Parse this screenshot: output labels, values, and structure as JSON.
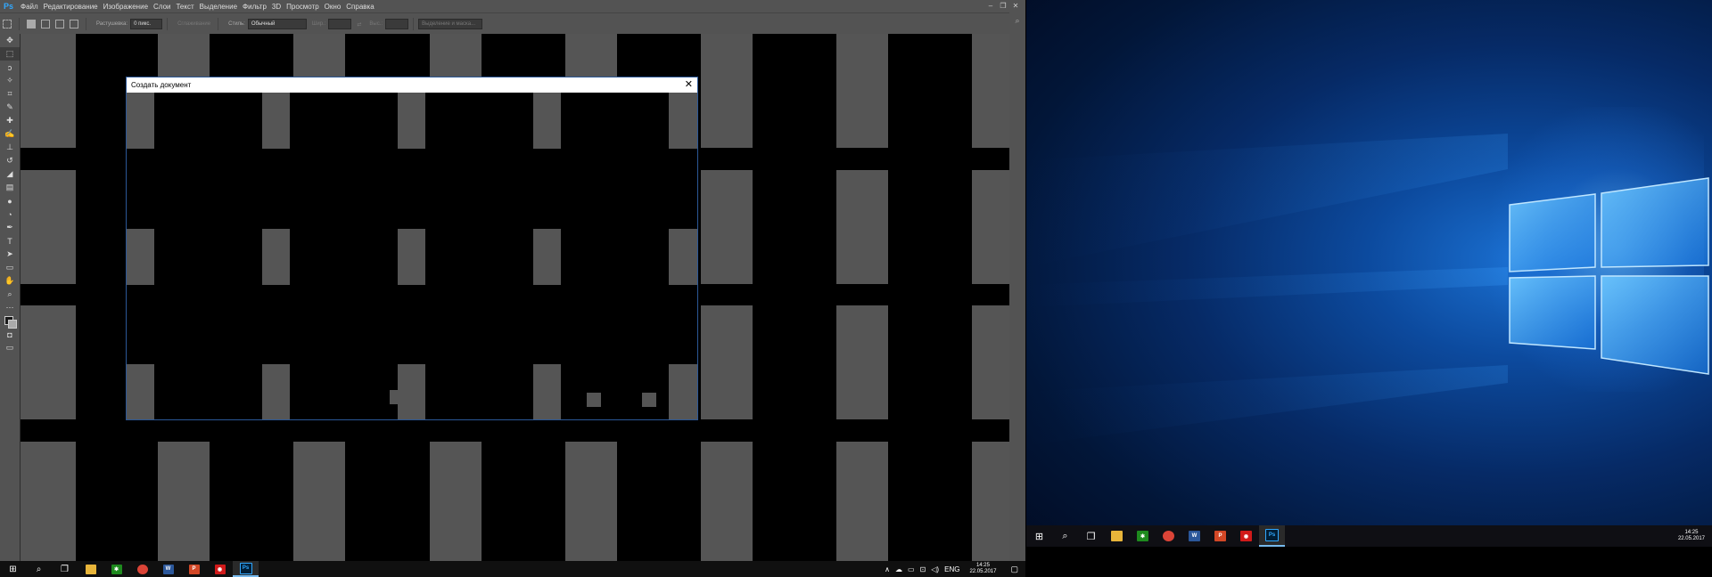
{
  "photoshop": {
    "logo": "Ps",
    "menu": [
      "Файл",
      "Редактирование",
      "Изображение",
      "Слои",
      "Текст",
      "Выделение",
      "Фильтр",
      "3D",
      "Просмотр",
      "Окно",
      "Справка"
    ],
    "window_controls": [
      "–",
      "❐",
      "✕"
    ],
    "options_bar": {
      "feather_label": "Растушевка:",
      "feather_value": "0 пикс.",
      "antialias_label": "Сглаживание",
      "style_label": "Стиль:",
      "style_value": "Обычный",
      "width_label": "Шир.:",
      "height_label": "Выс.:",
      "select_mask_label": "Выделение и маска..."
    },
    "tools": [
      "move-tool",
      "marquee-tool",
      "lasso-tool",
      "magic-wand-tool",
      "crop-tool",
      "eyedropper-tool",
      "healing-tool",
      "brush-tool",
      "stamp-tool",
      "history-brush-tool",
      "eraser-tool",
      "gradient-tool",
      "blur-tool",
      "dodge-tool",
      "pen-tool",
      "type-tool",
      "path-select-tool",
      "shape-tool",
      "hand-tool",
      "zoom-tool",
      "more-tools",
      "color-swatches",
      "quick-mask",
      "screen-mode"
    ],
    "tool_glyphs": [
      "✥",
      "⬚",
      "ↄ",
      "✧",
      "⌗",
      "✎",
      "✚",
      "✍",
      "⊥",
      "↺",
      "◢",
      "▤",
      "●",
      "◔",
      "✒",
      "T",
      "➤",
      "▭",
      "✋",
      "⌕",
      "⋯",
      "■",
      "◘",
      "▭"
    ]
  },
  "dialog": {
    "title": "Создать документ",
    "close_glyph": "✕"
  },
  "taskbar_left": {
    "start_glyph": "⊞",
    "search_glyph": "⌕",
    "taskview_glyph": "❐",
    "apps": [
      {
        "name": "file-explorer",
        "label": "",
        "color": "#e8b53a"
      },
      {
        "name": "app-green",
        "label": "✱",
        "color": "#1e8a1e"
      },
      {
        "name": "chrome",
        "label": "●",
        "color": "#db4437"
      },
      {
        "name": "word",
        "label": "W",
        "color": "#2b579a"
      },
      {
        "name": "powerpoint",
        "label": "P",
        "color": "#d24726"
      },
      {
        "name": "app-red",
        "label": "◉",
        "color": "#d11a1a"
      },
      {
        "name": "photoshop",
        "label": "Ps",
        "color": "#001e36"
      }
    ],
    "tray": {
      "chevron": "∧",
      "cloud": "☁",
      "battery": "▭",
      "network": "⊡",
      "volume": "◁)",
      "lang": "ENG"
    },
    "time": "14:25",
    "date": "22.05.2017",
    "notification_glyph": "▢"
  },
  "taskbar_right": {
    "time": "14:25",
    "date": "22.05.2017"
  },
  "colors": {
    "ps_panel": "#535353",
    "canvas_block": "#555555",
    "dialog_border": "#2b5797",
    "win_accent": "#76b9ed"
  }
}
